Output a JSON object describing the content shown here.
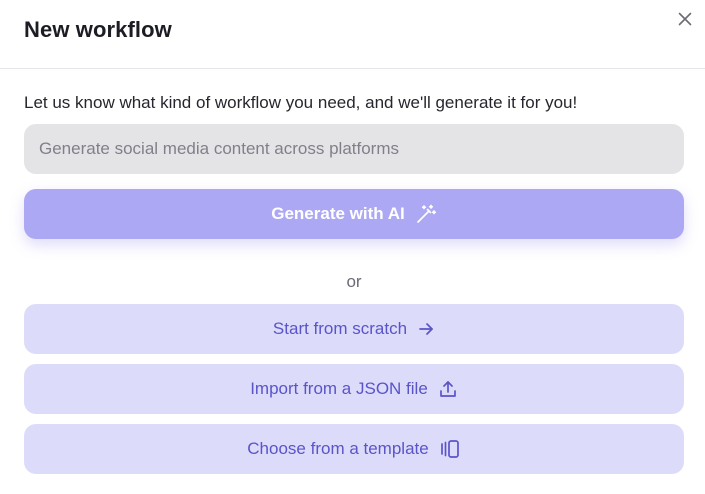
{
  "dialog": {
    "title": "New workflow",
    "close_icon": "close-icon"
  },
  "prompt": {
    "description": "Let us know what kind of workflow you need, and we'll generate it for you!",
    "input_placeholder": "Generate social media content across platforms",
    "input_value": ""
  },
  "actions": {
    "generate_label": "Generate with AI",
    "generate_icon": "magic-wand-icon",
    "or_label": "or",
    "scratch_label": "Start from scratch",
    "scratch_icon": "arrow-right-icon",
    "import_label": "Import from a JSON file",
    "import_icon": "upload-icon",
    "template_label": "Choose from a template",
    "template_icon": "template-carousel-icon"
  },
  "colors": {
    "primary_button": "#ada8f3",
    "secondary_button": "#dddbfa",
    "secondary_text": "#5a54c9",
    "input_background": "#e4e4e7"
  }
}
